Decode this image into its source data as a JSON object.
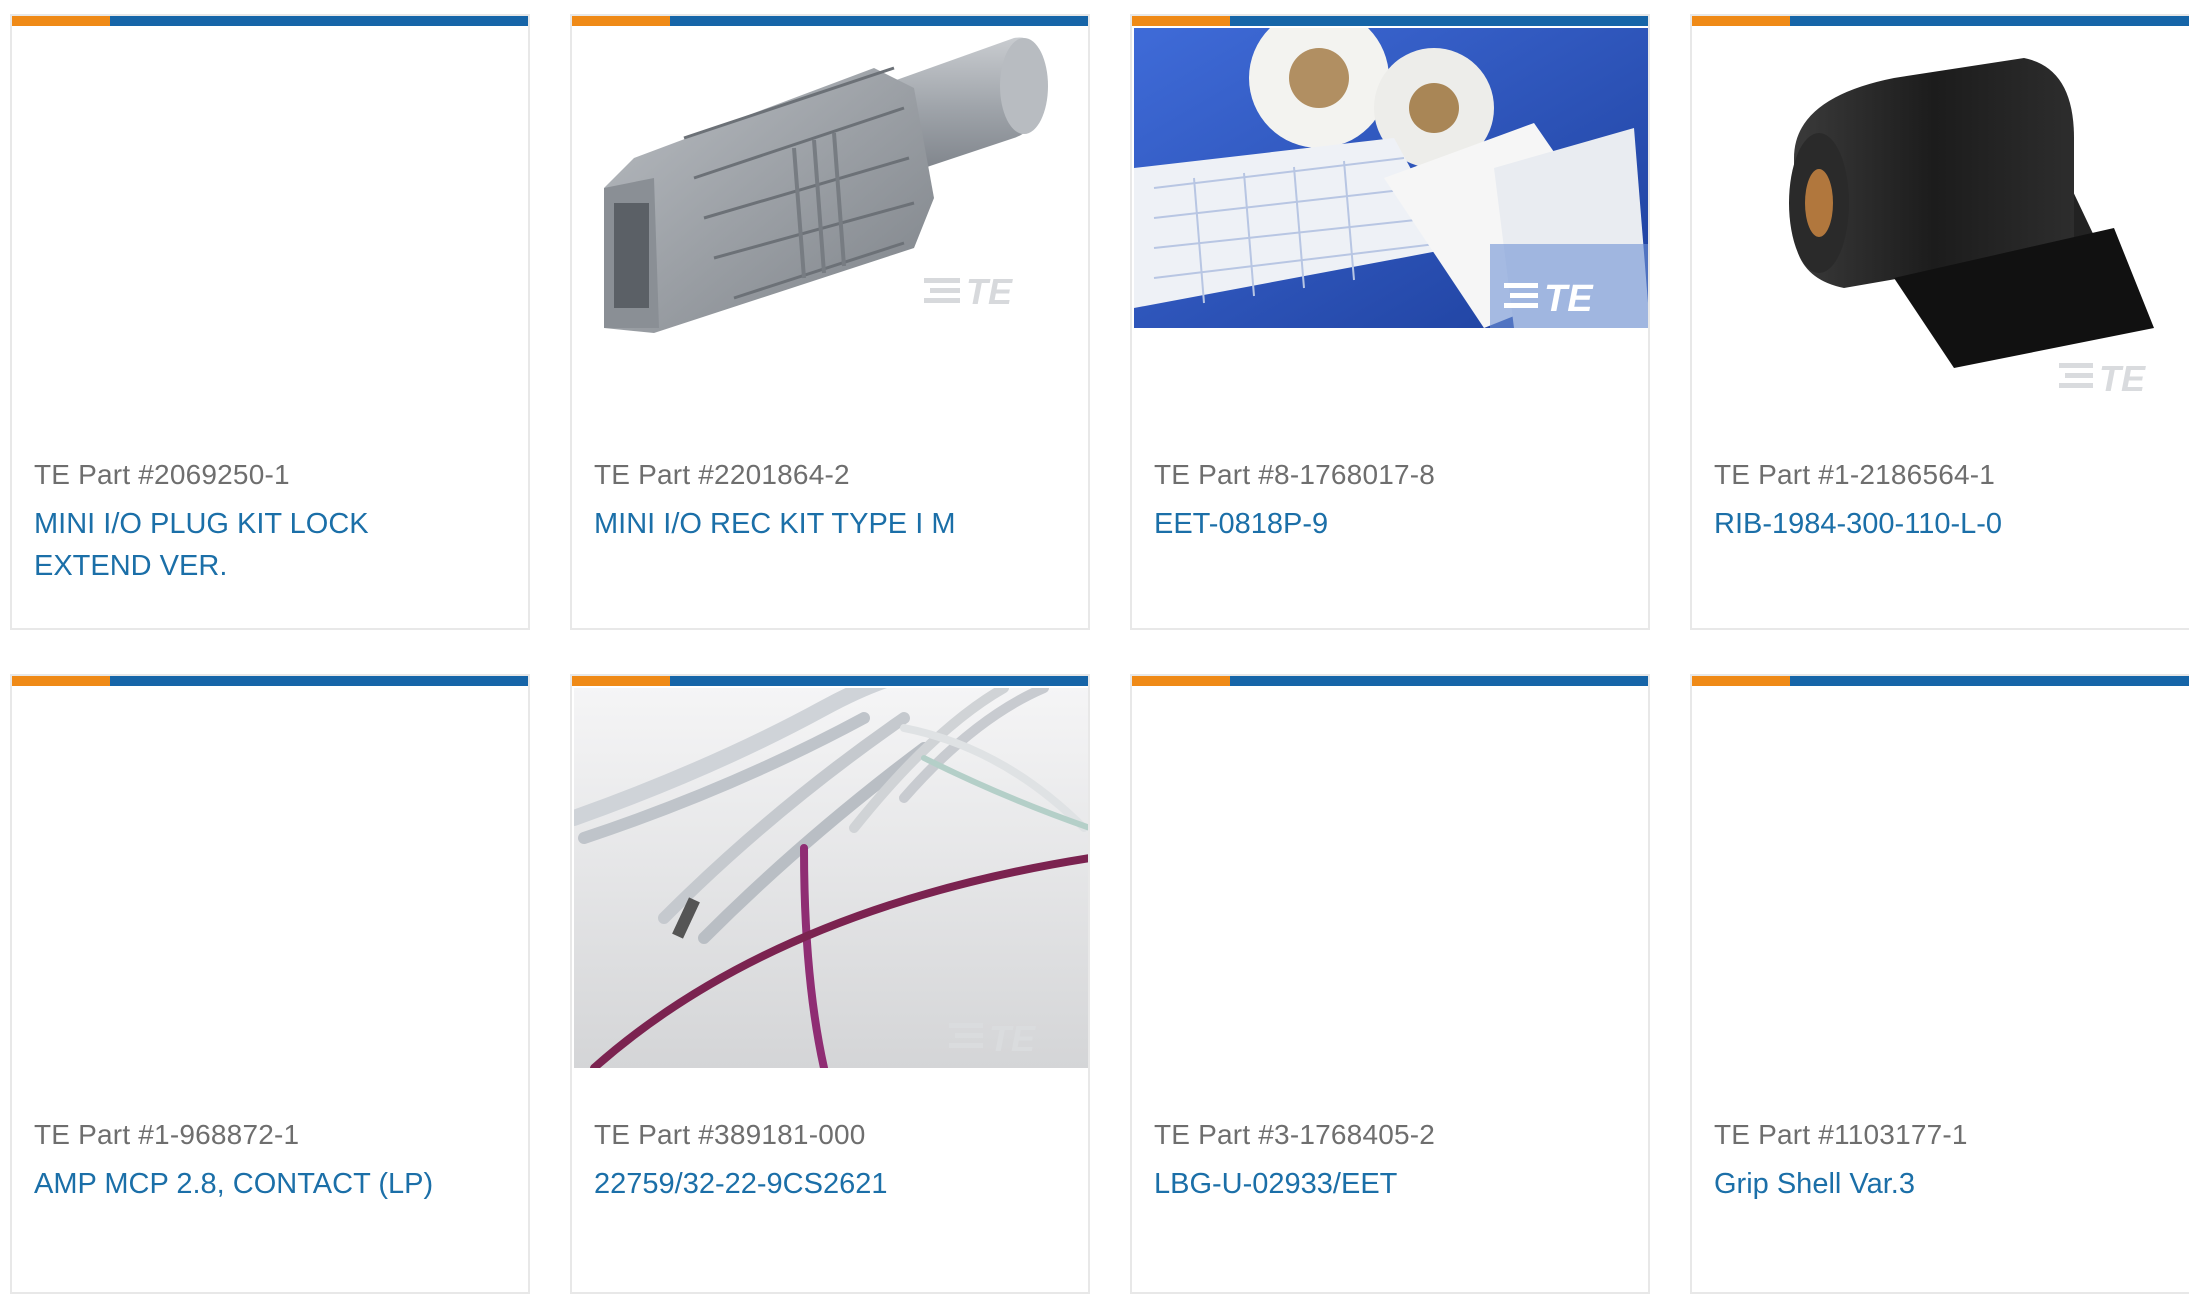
{
  "colors": {
    "accent_orange": "#ef8a17",
    "accent_blue": "#1665a8",
    "link": "#1b6fa8",
    "part_gray": "#6e6e6e"
  },
  "watermark": "TE",
  "cards": [
    {
      "part": "TE Part #2069250-1",
      "name": "MINI I/O PLUG KIT LOCK EXTEND VER.",
      "image": "none"
    },
    {
      "part": "TE Part #2201864-2",
      "name": "MINI I/O REC KIT TYPE I M",
      "image": "gray-connector-housing"
    },
    {
      "part": "TE Part #8-1768017-8",
      "name": "EET-0818P-9",
      "image": "label-rolls-on-blue"
    },
    {
      "part": "TE Part #1-2186564-1",
      "name": "RIB-1984-300-110-L-0",
      "image": "black-ribbon-roll"
    },
    {
      "part": "TE Part #1-968872-1",
      "name": "AMP MCP 2.8, CONTACT (LP)",
      "image": "none"
    },
    {
      "part": "TE Part #389181-000",
      "name": "22759/32-22-9CS2621",
      "image": "insulated-wires"
    },
    {
      "part": "TE Part #3-1768405-2",
      "name": "LBG-U-02933/EET",
      "image": "none"
    },
    {
      "part": "TE Part #1103177-1",
      "name": "Grip Shell Var.3",
      "image": "none"
    }
  ]
}
